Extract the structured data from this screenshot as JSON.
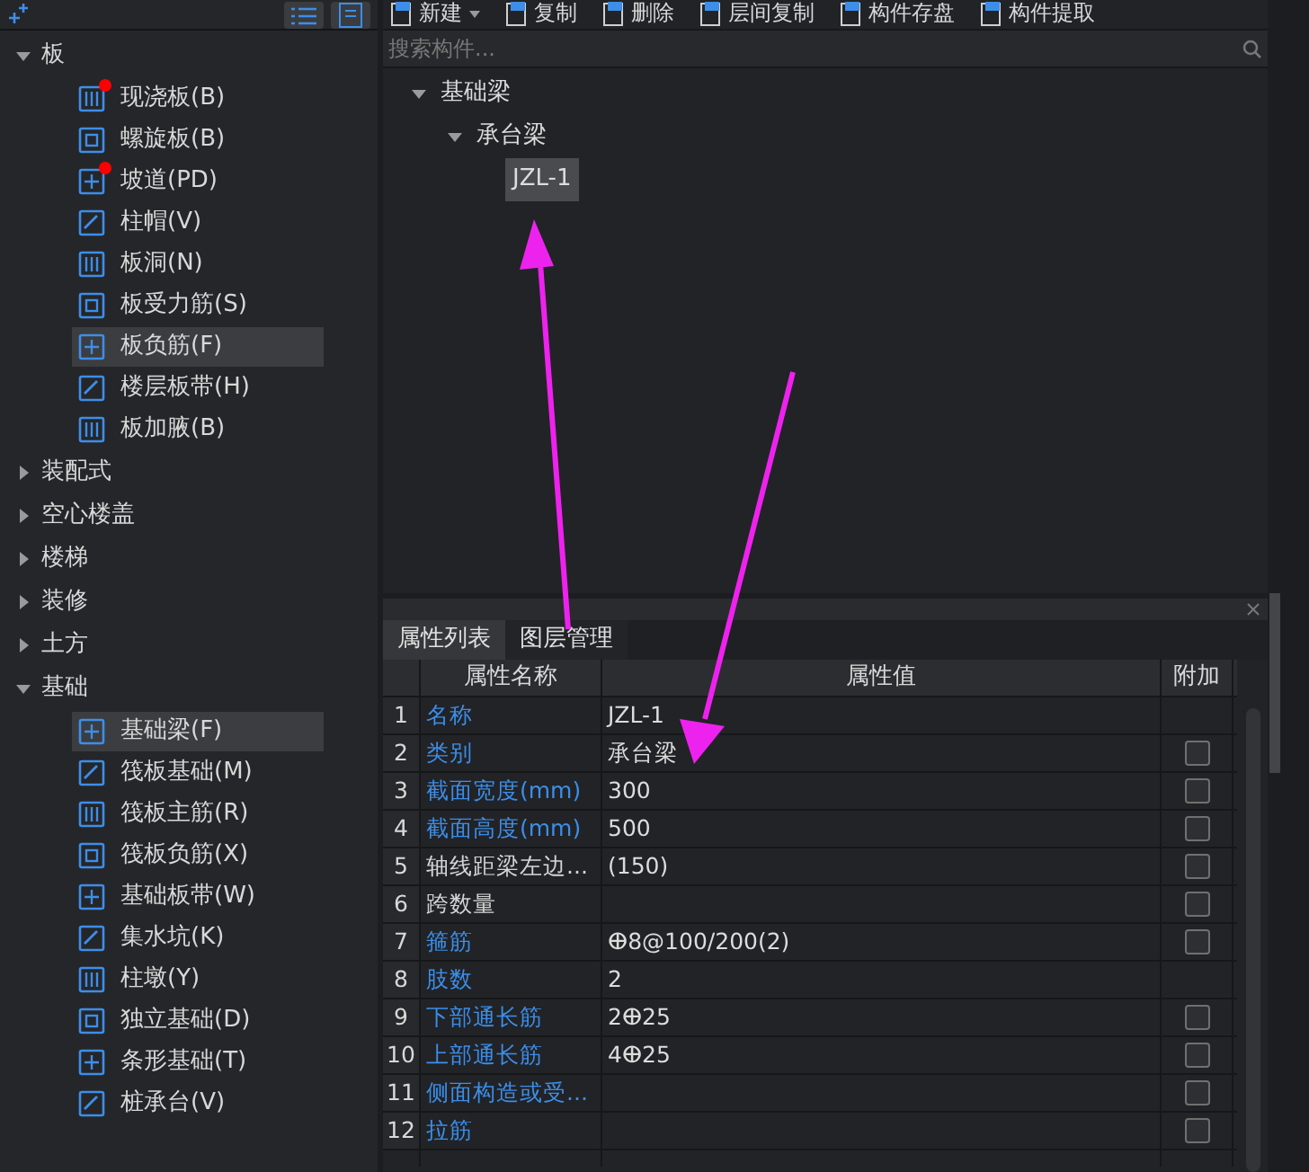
{
  "sidebar": {
    "groups": [
      {
        "label": "板",
        "expanded": true,
        "items": [
          {
            "label": "现浇板(B)",
            "marked": true,
            "selected": false
          },
          {
            "label": "螺旋板(B)",
            "marked": false,
            "selected": false
          },
          {
            "label": "坡道(PD)",
            "marked": true,
            "selected": false
          },
          {
            "label": "柱帽(V)",
            "marked": false,
            "selected": false
          },
          {
            "label": "板洞(N)",
            "marked": false,
            "selected": false
          },
          {
            "label": "板受力筋(S)",
            "marked": false,
            "selected": false
          },
          {
            "label": "板负筋(F)",
            "marked": false,
            "selected": true
          },
          {
            "label": "楼层板带(H)",
            "marked": false,
            "selected": false
          },
          {
            "label": "板加腋(B)",
            "marked": false,
            "selected": false
          }
        ]
      },
      {
        "label": "装配式",
        "expanded": false
      },
      {
        "label": "空心楼盖",
        "expanded": false
      },
      {
        "label": "楼梯",
        "expanded": false
      },
      {
        "label": "装修",
        "expanded": false
      },
      {
        "label": "土方",
        "expanded": false
      },
      {
        "label": "基础",
        "expanded": true,
        "items": [
          {
            "label": "基础梁(F)",
            "marked": false,
            "selected": true
          },
          {
            "label": "筏板基础(M)",
            "marked": false,
            "selected": false
          },
          {
            "label": "筏板主筋(R)",
            "marked": false,
            "selected": false
          },
          {
            "label": "筏板负筋(X)",
            "marked": false,
            "selected": false
          },
          {
            "label": "基础板带(W)",
            "marked": false,
            "selected": false
          },
          {
            "label": "集水坑(K)",
            "marked": false,
            "selected": false
          },
          {
            "label": "柱墩(Y)",
            "marked": false,
            "selected": false
          },
          {
            "label": "独立基础(D)",
            "marked": false,
            "selected": false
          },
          {
            "label": "条形基础(T)",
            "marked": false,
            "selected": false
          },
          {
            "label": "桩承台(V)",
            "marked": false,
            "selected": false
          }
        ]
      }
    ]
  },
  "toolbar": [
    {
      "label": "新建",
      "dropdown": true
    },
    {
      "label": "复制",
      "dropdown": false
    },
    {
      "label": "删除",
      "dropdown": false
    },
    {
      "label": "层间复制",
      "dropdown": false
    },
    {
      "label": "构件存盘",
      "dropdown": false
    },
    {
      "label": "构件提取",
      "dropdown": false
    }
  ],
  "search": {
    "placeholder": "搜索构件..."
  },
  "component_tree": [
    {
      "label": "基础梁",
      "expanded": true,
      "selected": false,
      "children": [
        {
          "label": "承台梁",
          "expanded": true,
          "selected": false,
          "children": [
            {
              "label": "JZL-1",
              "selected": true
            }
          ]
        }
      ]
    }
  ],
  "tabs": [
    {
      "label": "属性列表",
      "selected": true
    },
    {
      "label": "图层管理",
      "selected": false
    }
  ],
  "table": {
    "columns": [
      "属性名称",
      "属性值",
      "附加"
    ],
    "rows": [
      {
        "index": "1",
        "name": "名称",
        "value": "JZL-1",
        "color": "#3b8eea"
      },
      {
        "index": "2",
        "name": "类别",
        "value": "承台梁",
        "color": "#3b8eea",
        "checked": false
      },
      {
        "index": "3",
        "name": "截面宽度(mm)",
        "value": "300",
        "color": "#3b8eea",
        "checked": false
      },
      {
        "index": "4",
        "name": "截面高度(mm)",
        "value": "500",
        "color": "#3b8eea",
        "checked": false
      },
      {
        "index": "5",
        "name": "轴线距梁左边...",
        "value": "(150)",
        "color": "#d4d4d4",
        "checked": false
      },
      {
        "index": "6",
        "name": "跨数量",
        "value": "",
        "color": "#d4d4d4",
        "checked": false
      },
      {
        "index": "7",
        "name": "箍筋",
        "value": "ⴲ8@100/200(2)",
        "color": "#3b8eea",
        "checked": false
      },
      {
        "index": "8",
        "name": "肢数",
        "value": "2",
        "color": "#3b8eea"
      },
      {
        "index": "9",
        "name": "下部通长筋",
        "value": "2ⴲ25",
        "color": "#3b8eea",
        "checked": false
      },
      {
        "index": "10",
        "name": "上部通长筋",
        "value": "4ⴲ25",
        "color": "#3b8eea",
        "checked": false
      },
      {
        "index": "11",
        "name": "侧面构造或受...",
        "value": "",
        "color": "#3b8eea",
        "checked": false
      },
      {
        "index": "12",
        "name": "拉筋",
        "value": "",
        "color": "#3b8eea",
        "checked": false
      }
    ]
  }
}
